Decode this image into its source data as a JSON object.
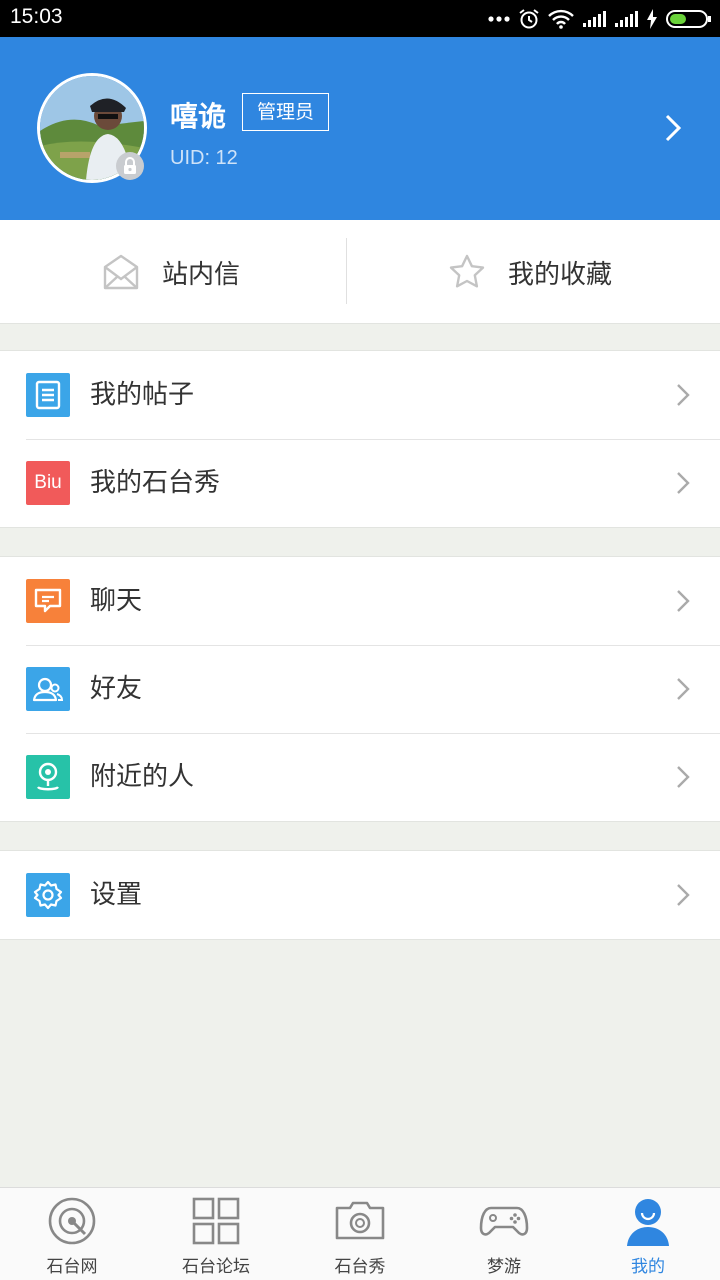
{
  "status_bar": {
    "time": "15:03"
  },
  "profile": {
    "username": "嘻诡",
    "role": "管理员",
    "uid": "UID: 12"
  },
  "quick_actions": [
    {
      "label": "站内信",
      "icon": "mail-icon"
    },
    {
      "label": "我的收藏",
      "icon": "star-icon"
    }
  ],
  "menu_groups": [
    [
      {
        "label": "我的帖子",
        "icon": "document-icon",
        "color": "#3ba5e8"
      },
      {
        "label": "我的石台秀",
        "icon": "biu-icon",
        "icon_text": "Biu",
        "color": "#f15a5a"
      }
    ],
    [
      {
        "label": "聊天",
        "icon": "chat-icon",
        "color": "#f7813a"
      },
      {
        "label": "好友",
        "icon": "friends-icon",
        "color": "#3ba5e8"
      },
      {
        "label": "附近的人",
        "icon": "location-icon",
        "color": "#27c2a8"
      }
    ],
    [
      {
        "label": "设置",
        "icon": "gear-icon",
        "color": "#3ba5e8"
      }
    ]
  ],
  "tabs": [
    {
      "label": "石台网",
      "icon": "home-logo-icon"
    },
    {
      "label": "石台论坛",
      "icon": "grid-icon"
    },
    {
      "label": "石台秀",
      "icon": "camera-icon"
    },
    {
      "label": "梦游",
      "icon": "gamepad-icon"
    },
    {
      "label": "我的",
      "icon": "person-icon",
      "active": true
    }
  ],
  "colors": {
    "primary": "#2f86e0",
    "background": "#eff1ec"
  }
}
